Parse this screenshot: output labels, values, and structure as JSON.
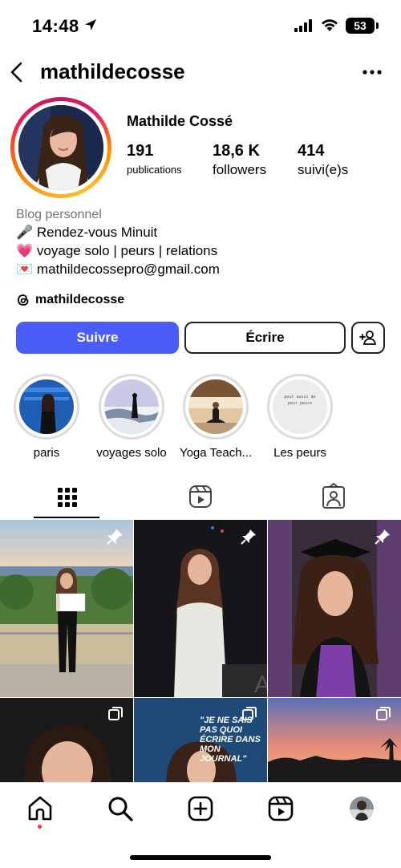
{
  "status_bar": {
    "time": "14:48",
    "battery": "53"
  },
  "header": {
    "username": "mathildecosse"
  },
  "profile": {
    "full_name": "Mathilde Cossé",
    "stats": [
      {
        "value": "191",
        "label": "publications"
      },
      {
        "value": "18,6 K",
        "label": "followers"
      },
      {
        "value": "414",
        "label": "suivi(e)s"
      }
    ]
  },
  "bio": {
    "category": "Blog personnel",
    "lines": [
      {
        "emoji": "🎤",
        "text": "Rendez-vous Minuit"
      },
      {
        "emoji": "💗",
        "text": "voyage solo | peurs | relations"
      },
      {
        "emoji": "💌",
        "text": "mathildecossepro@gmail.com"
      }
    ],
    "threads_handle": "mathildecosse"
  },
  "actions": {
    "follow_label": "Suivre",
    "message_label": "Écrire"
  },
  "highlights": [
    {
      "label": "paris"
    },
    {
      "label": "voyages solo"
    },
    {
      "label": "Yoga Teach..."
    },
    {
      "label": "Les peurs"
    }
  ],
  "highlight_paper_text": "peut aussi de peur peurs",
  "grid_post_text": "\"JE NE SAIS PAS QUOI ÉCRIRE DANS MON JOURNAL\"",
  "colors": {
    "accent": "#4a5df9",
    "notification_dot": "#ff3040"
  }
}
